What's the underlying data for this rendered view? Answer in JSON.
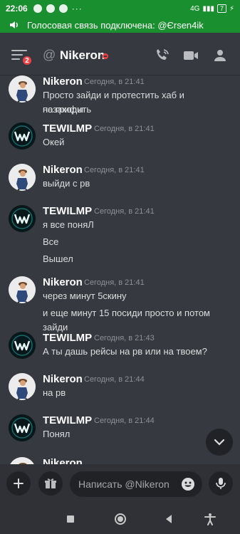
{
  "status_bar": {
    "time": "22:06",
    "network": "4G",
    "battery": "7"
  },
  "voice_banner": {
    "text": "Голосовая связь подключена: @Єrsen4ik"
  },
  "header": {
    "at_symbol": "@",
    "dm_name": "Nikeron",
    "unread_badge": "2"
  },
  "messages": [
    {
      "author": "Nikeron",
      "time": "Сегодня, в 21:41",
      "lines": [
        "Просто зайди и протестить хаб и позаходить",
        "на грифы"
      ]
    },
    {
      "author": "TEWILMP",
      "time": "Сегодня, в 21:41",
      "lines": [
        "Окей"
      ]
    },
    {
      "author": "Nikeron",
      "time": "Сегодня, в 21:41",
      "lines": [
        "выйди с рв"
      ]
    },
    {
      "author": "TEWILMP",
      "time": "Сегодня, в 21:41",
      "lines": [
        "я все поняЛ",
        "Все",
        "Вышел"
      ]
    },
    {
      "author": "Nikeron",
      "time": "Сегодня, в 21:41",
      "lines": [
        "через минут 5скину",
        "и еще минут 15 посиди просто и потом зайди"
      ]
    },
    {
      "author": "TEWILMP",
      "time": "Сегодня, в 21:43",
      "lines": [
        "А ты дашь рейсы на рв или на твоем?"
      ]
    },
    {
      "author": "Nikeron",
      "time": "Сегодня, в 21:44",
      "lines": [
        "на рв"
      ]
    },
    {
      "author": "TEWILMP",
      "time": "Сегодня, в 21:44",
      "lines": [
        "Понял"
      ]
    },
    {
      "author": "Nikeron",
      "time": "",
      "lines": []
    }
  ],
  "composer": {
    "placeholder": "Написать @Nikeron"
  },
  "colors": {
    "accent_green": "#1a8f2f",
    "background": "#36393f",
    "badge_red": "#ed4245"
  }
}
